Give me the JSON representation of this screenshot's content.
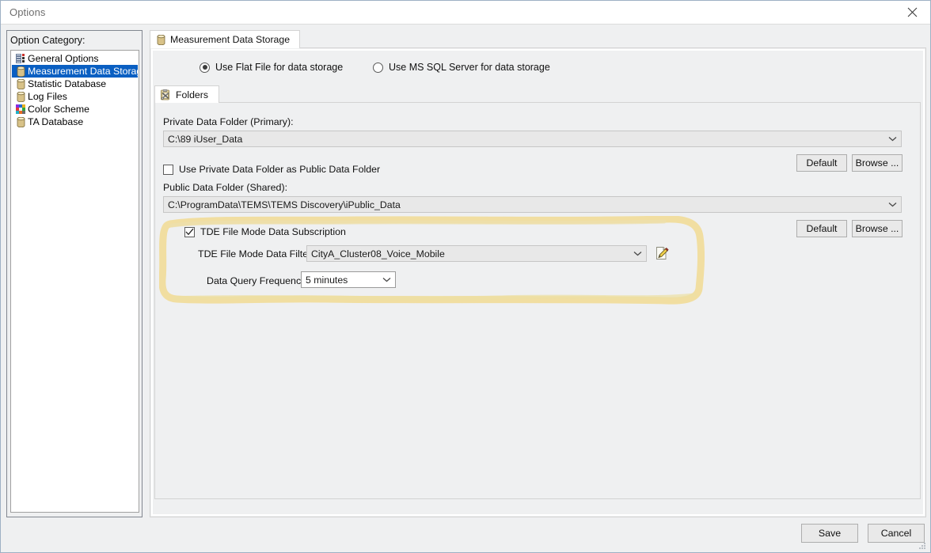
{
  "window": {
    "title": "Options",
    "close_icon": "close-icon"
  },
  "sidebar": {
    "header": "Option Category:",
    "items": [
      {
        "label": "General Options",
        "icon": "list-options-icon",
        "selected": false
      },
      {
        "label": "Measurement Data Storage",
        "icon": "database-icon",
        "selected": true
      },
      {
        "label": "Statistic Database",
        "icon": "database-icon",
        "selected": false
      },
      {
        "label": "Log Files",
        "icon": "database-icon",
        "selected": false
      },
      {
        "label": "Color Scheme",
        "icon": "color-palette-icon",
        "selected": false
      },
      {
        "label": "TA Database",
        "icon": "database-icon",
        "selected": false
      }
    ]
  },
  "main": {
    "tab": {
      "label": "Measurement Data Storage",
      "icon": "database-icon"
    },
    "storage_mode": {
      "options": [
        {
          "label": "Use Flat File for data storage",
          "selected": true
        },
        {
          "label": "Use MS SQL Server for data storage",
          "selected": false
        }
      ]
    },
    "inner_tab": {
      "label": "Folders",
      "icon": "folder-tools-icon"
    },
    "private_folder": {
      "label": "Private Data Folder (Primary):",
      "value": "C:\\89 iUser_Data",
      "default_button": "Default",
      "browse_button": "Browse ..."
    },
    "use_private_as_public": {
      "label": "Use Private Data Folder as Public Data Folder",
      "checked": false
    },
    "public_folder": {
      "label": "Public Data Folder (Shared):",
      "value": "C:\\ProgramData\\TEMS\\TEMS Discovery\\iPublic_Data",
      "default_button": "Default",
      "browse_button": "Browse ..."
    },
    "tde": {
      "subscription": {
        "label": "TDE File Mode Data Subscription",
        "checked": true
      },
      "filter": {
        "label": "TDE File Mode Data Filter",
        "value": "CityA_Cluster08_Voice_Mobile",
        "edit_icon": "edit-pencil-icon"
      },
      "frequency": {
        "label": "Data Query Frequency",
        "value": "5 minutes"
      }
    },
    "annotation": {
      "color": "#f2dd9a",
      "shape": "hand-drawn-rounded-rectangle"
    }
  },
  "footer": {
    "save_button": "Save",
    "cancel_button": "Cancel"
  }
}
